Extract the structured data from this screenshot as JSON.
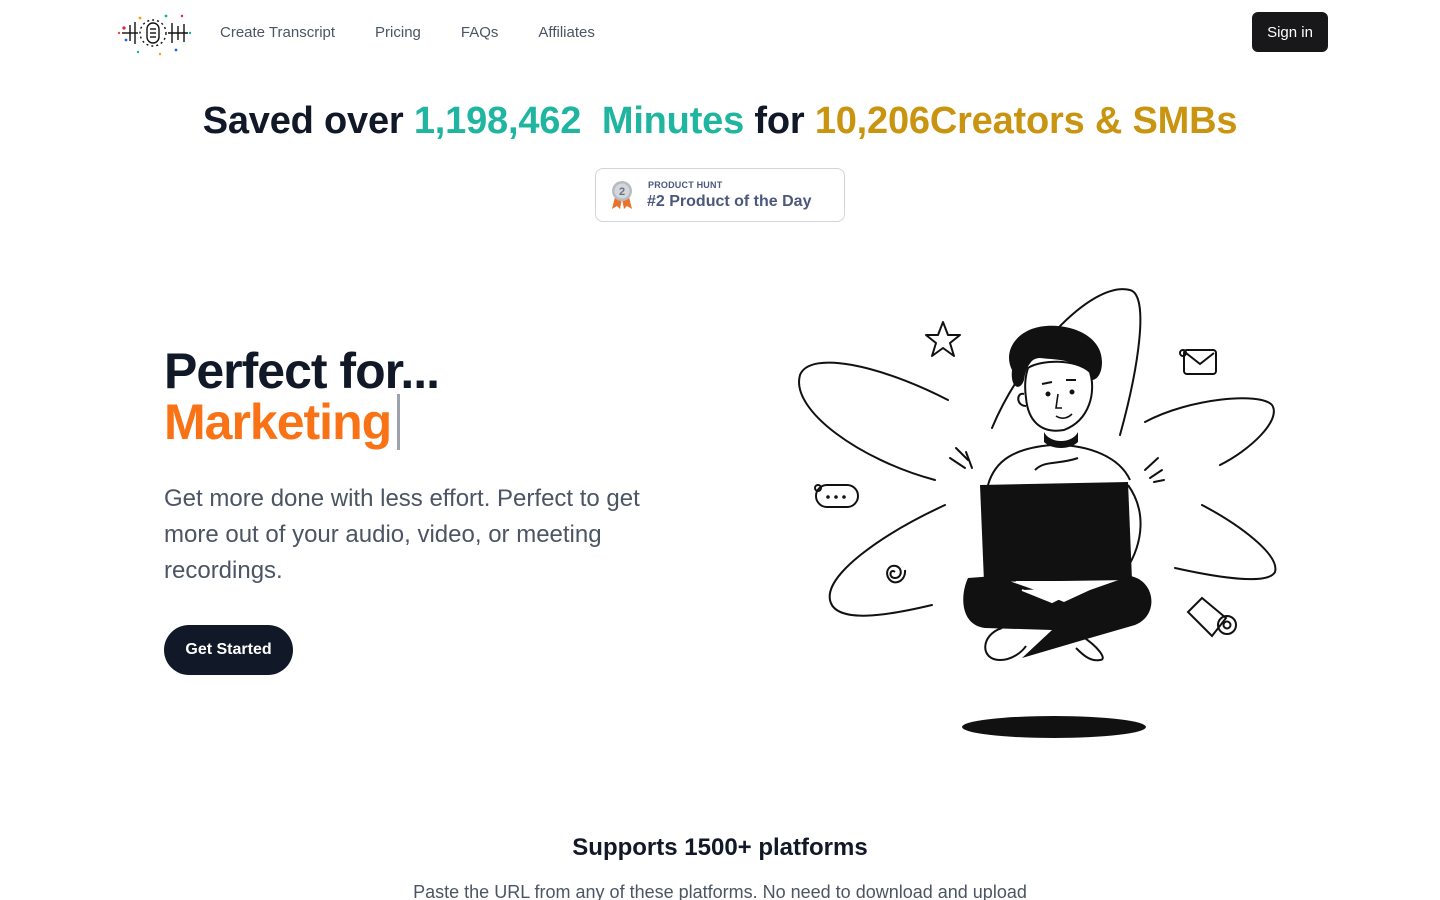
{
  "header": {
    "nav": [
      "Create Transcript",
      "Pricing",
      "FAQs",
      "Affiliates"
    ],
    "signin_label": "Sign in"
  },
  "stats": {
    "prefix": "Saved over",
    "minutes_count": "1,198,462",
    "minutes_label": "Minutes",
    "connector": "for",
    "creators_count": "10,206",
    "creators_label": "Creators & SMBs"
  },
  "badge": {
    "rank": "2",
    "small": "PRODUCT HUNT",
    "big": "#2 Product of the Day"
  },
  "hero": {
    "title": "Perfect for...",
    "typed": "Marketing",
    "description": "Get more done with less effort. Perfect to get more out of your audio, video, or meeting recordings.",
    "cta_label": "Get Started"
  },
  "platforms": {
    "title": "Supports 1500+ platforms",
    "subtitle": "Paste the URL from any of these platforms. No need to download and upload"
  },
  "colors": {
    "teal": "#1fb5a0",
    "gold": "#c99410",
    "orange": "#f97316",
    "dark": "#111827"
  }
}
